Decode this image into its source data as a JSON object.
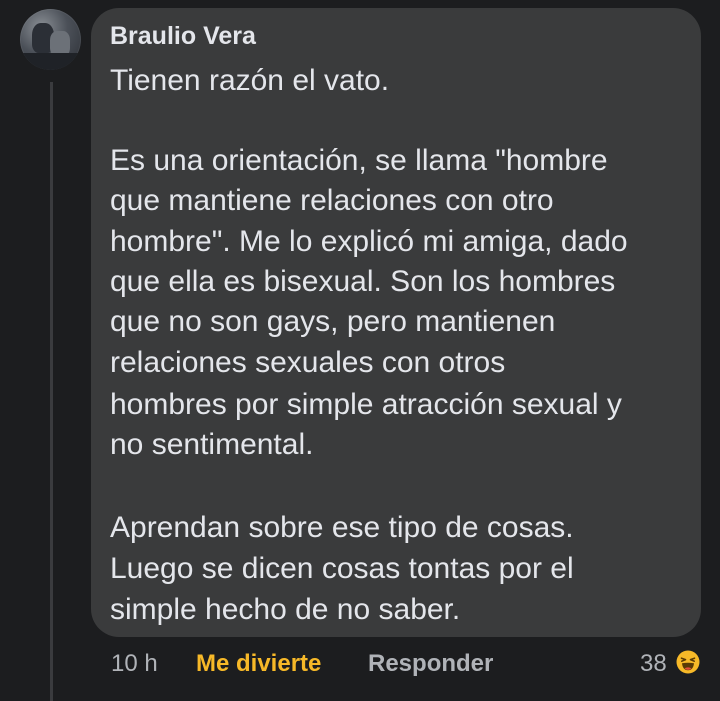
{
  "comment": {
    "author": "Braulio Vera",
    "lines": [
      "Tienen razón el vato.",
      "Es una orientación, se llama \"hombre",
      "que mantiene relaciones con otro",
      "hombre\". Me lo explicó mi amiga, dado",
      "que ella es bisexual. Son los hombres",
      "que no son gays, pero mantienen",
      "relaciones sexuales con otros",
      "hombres por simple atracción sexual y",
      "no sentimental.",
      "Aprendan sobre ese tipo de cosas.",
      "Luego se dicen cosas tontas por el",
      "simple hecho de no saber."
    ]
  },
  "actions": {
    "time": "10 h",
    "reaction_label": "Me divierte",
    "reply_label": "Responder",
    "reaction_count": "38",
    "reaction_icon": "haha-emoji-icon"
  },
  "colors": {
    "background": "#1c1d1f",
    "bubble": "#3a3b3c",
    "text": "#e4e6eb",
    "muted": "#b0b3b8",
    "reaction": "#f7b928"
  }
}
